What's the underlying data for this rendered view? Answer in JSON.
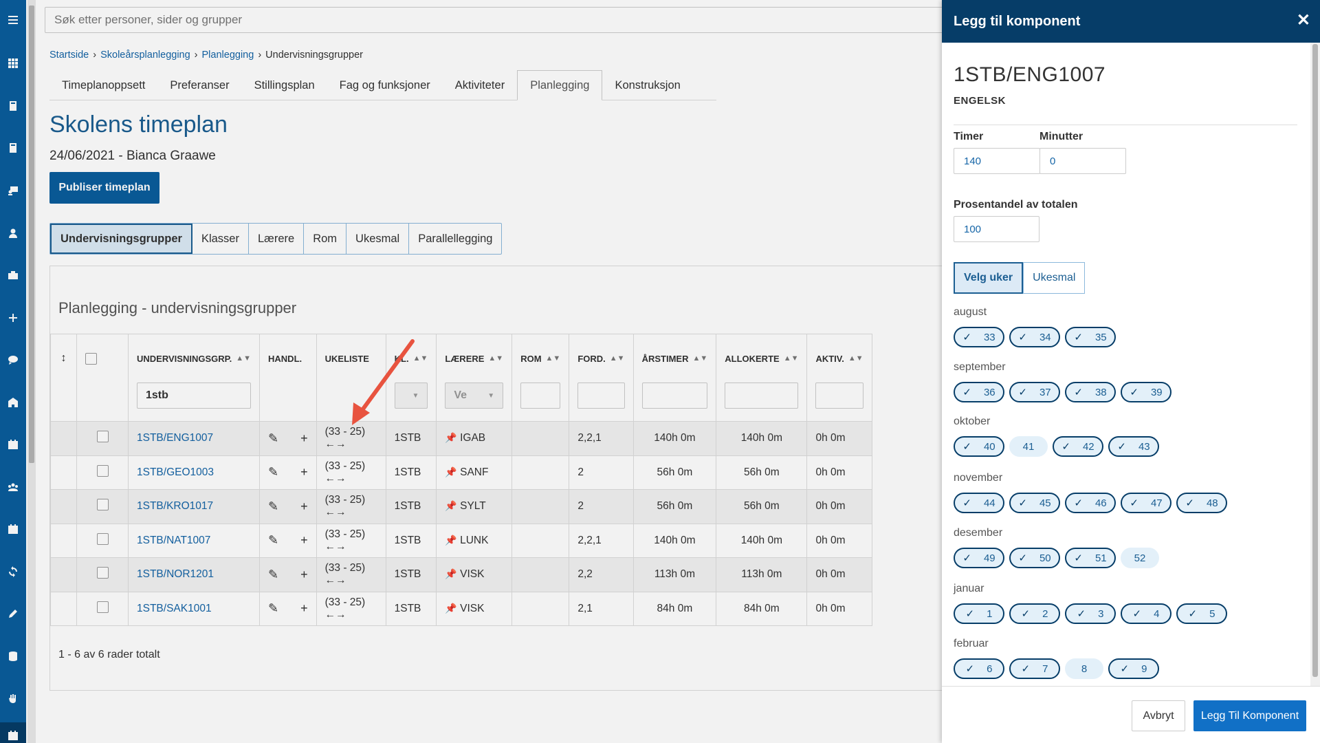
{
  "search": {
    "placeholder": "Søk etter personer, sider og grupper"
  },
  "breadcrumb": [
    "Startside",
    "Skoleårsplanlegging",
    "Planlegging",
    "Undervisningsgrupper"
  ],
  "tabs": [
    "Timeplanoppsett",
    "Preferanser",
    "Stillingsplan",
    "Fag og funksjoner",
    "Aktiviteter",
    "Planlegging",
    "Konstruksjon"
  ],
  "page": {
    "title": "Skolens timeplan",
    "subtitle": "24/06/2021 - Bianca Graawe",
    "publish_label": "Publiser timeplan"
  },
  "segments": [
    "Undervisningsgrupper",
    "Klasser",
    "Lærere",
    "Rom",
    "Ukesmal",
    "Parallellegging"
  ],
  "panel": {
    "title": "Planlegging - undervisningsgrupper",
    "columns": [
      "UNDERVISNINGSGRP.",
      "HANDL.",
      "UKELISTE",
      "KL.",
      "LÆRERE",
      "ROM",
      "FORD.",
      "ÅRSTIMER",
      "ALLOKERTE",
      "AKTIV."
    ],
    "filter_group": "1stb",
    "filter_teacher": "Ve",
    "rows": [
      {
        "group": "1STB/ENG1007",
        "weeks": "(33 - 25)",
        "class": "1STB",
        "teacher": "IGAB",
        "dist": "2,2,1",
        "year": "140h 0m",
        "alloc": "140h 0m",
        "active": "0h 0m"
      },
      {
        "group": "1STB/GEO1003",
        "weeks": "(33 - 25)",
        "class": "1STB",
        "teacher": "SANF",
        "dist": "2",
        "year": "56h 0m",
        "alloc": "56h 0m",
        "active": "0h 0m"
      },
      {
        "group": "1STB/KRO1017",
        "weeks": "(33 - 25)",
        "class": "1STB",
        "teacher": "SYLT",
        "dist": "2",
        "year": "56h 0m",
        "alloc": "56h 0m",
        "active": "0h 0m"
      },
      {
        "group": "1STB/NAT1007",
        "weeks": "(33 - 25)",
        "class": "1STB",
        "teacher": "LUNK",
        "dist": "2,2,1",
        "year": "140h 0m",
        "alloc": "140h 0m",
        "active": "0h 0m"
      },
      {
        "group": "1STB/NOR1201",
        "weeks": "(33 - 25)",
        "class": "1STB",
        "teacher": "VISK",
        "dist": "2,2",
        "year": "113h 0m",
        "alloc": "113h 0m",
        "active": "0h 0m"
      },
      {
        "group": "1STB/SAK1001",
        "weeks": "(33 - 25)",
        "class": "1STB",
        "teacher": "VISK",
        "dist": "2,1",
        "year": "84h 0m",
        "alloc": "84h 0m",
        "active": "0h 0m"
      }
    ],
    "footer": "1 - 6 av 6 rader totalt"
  },
  "drawer": {
    "title": "Legg til komponent",
    "code": "1STB/ENG1007",
    "subject": "ENGELSK",
    "hours_label": "Timer",
    "hours_value": "140",
    "minutes_label": "Minutter",
    "minutes_value": "0",
    "percent_label": "Prosentandel av totalen",
    "percent_value": "100",
    "toggle": [
      "Velg uker",
      "Ukesmal"
    ],
    "months": [
      {
        "name": "august",
        "weeks": [
          {
            "n": "33",
            "on": true
          },
          {
            "n": "34",
            "on": true
          },
          {
            "n": "35",
            "on": true
          }
        ]
      },
      {
        "name": "september",
        "weeks": [
          {
            "n": "36",
            "on": true
          },
          {
            "n": "37",
            "on": true
          },
          {
            "n": "38",
            "on": true
          },
          {
            "n": "39",
            "on": true
          }
        ]
      },
      {
        "name": "oktober",
        "weeks": [
          {
            "n": "40",
            "on": true
          },
          {
            "n": "41",
            "on": false
          },
          {
            "n": "42",
            "on": true
          },
          {
            "n": "43",
            "on": true
          }
        ]
      },
      {
        "name": "november",
        "weeks": [
          {
            "n": "44",
            "on": true
          },
          {
            "n": "45",
            "on": true
          },
          {
            "n": "46",
            "on": true
          },
          {
            "n": "47",
            "on": true
          },
          {
            "n": "48",
            "on": true
          }
        ]
      },
      {
        "name": "desember",
        "weeks": [
          {
            "n": "49",
            "on": true
          },
          {
            "n": "50",
            "on": true
          },
          {
            "n": "51",
            "on": true
          },
          {
            "n": "52",
            "on": false
          }
        ]
      },
      {
        "name": "januar",
        "weeks": [
          {
            "n": "1",
            "on": true
          },
          {
            "n": "2",
            "on": true
          },
          {
            "n": "3",
            "on": true
          },
          {
            "n": "4",
            "on": true
          },
          {
            "n": "5",
            "on": true
          }
        ]
      },
      {
        "name": "februar",
        "weeks": [
          {
            "n": "6",
            "on": true
          },
          {
            "n": "7",
            "on": true
          },
          {
            "n": "8",
            "on": false
          },
          {
            "n": "9",
            "on": true
          }
        ]
      }
    ],
    "cancel_label": "Avbryt",
    "add_label": "Legg Til Komponent"
  },
  "colors": {
    "primary": "#0a5d9c",
    "header": "#063d68",
    "link": "#1565a7",
    "annotation_arrow": "#e8533f"
  },
  "icons": [
    "menu-icon",
    "apps-icon",
    "book-icon",
    "book-icon",
    "monitor-user-icon",
    "teacher-icon",
    "briefcase-icon",
    "plus-icon",
    "chat-icon",
    "school-icon",
    "calendar-icon",
    "group-icon",
    "calendar-check-icon",
    "sync-icon",
    "pencil-icon",
    "database-icon",
    "hand-icon",
    "calendar-icon"
  ]
}
